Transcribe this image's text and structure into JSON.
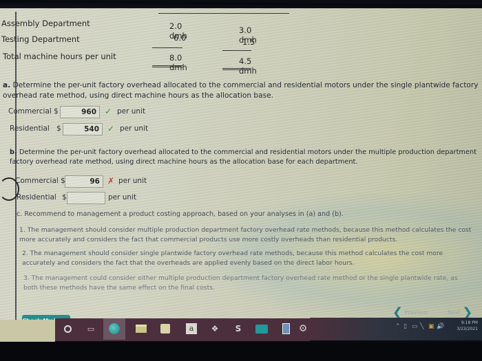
{
  "hours_table": {
    "rows": [
      {
        "label": "Assembly Department",
        "commercial": "2.0 dmh",
        "residential": "3.0 dmh"
      },
      {
        "label": "Testing Department",
        "commercial": "6.0",
        "residential": "1.5"
      },
      {
        "label": "Total machine hours per unit",
        "commercial": "8.0 dmh",
        "residential": "4.5 dmh"
      }
    ]
  },
  "part_a": {
    "letter": "a.",
    "question": "Determine the per-unit factory overhead allocated to the commercial and residential motors under the single plantwide factory overhead rate method, using direct machine hours as the allocation base.",
    "answers": [
      {
        "label": "Commercial",
        "currency": "$",
        "value": "960",
        "status": "correct",
        "mark": "✓",
        "unit": "per unit"
      },
      {
        "label": "Residential",
        "currency": "$",
        "value": "540",
        "status": "correct",
        "mark": "✓",
        "unit": "per unit"
      }
    ]
  },
  "part_b": {
    "letter": "b.",
    "question": "Determine the per-unit factory overhead allocated to the commercial and residential motors under the multiple production department factory overhead rate method, using direct machine hours as the allocation base for each department.",
    "answers": [
      {
        "label": "Commercial",
        "currency": "$",
        "value": "96",
        "status": "incorrect",
        "mark": "✗",
        "unit": "per unit"
      },
      {
        "label": "Residential",
        "currency": "$",
        "value": "",
        "status": "empty",
        "mark": "",
        "unit": "per unit"
      }
    ]
  },
  "part_c": {
    "letter": "c.",
    "question": "Recommend to management a product costing approach, based on your analyses in (a) and (b).",
    "options": [
      "1. The management should consider multiple production department factory overhead rate methods, because this method calculates the cost more accurately and considers the fact that commercial products use more costly overheads than residential products.",
      "2. The management should consider single plantwide factory overhead rate methods, because this method calculates the cost more accurately and considers the fact that the overheads are applied evenly based on the direct labor hours.",
      "3. The management could consider either multiple production department factory overhead rate method or the single plantwide rate, as both these methods have the same effect on the final costs."
    ]
  },
  "footer": {
    "check_my_work": "Check My Work",
    "previous": "Previous",
    "next": "Next"
  },
  "taskbar": {
    "icons": [
      "cortana-icon",
      "task-view-icon",
      "edge-browser-icon",
      "file-explorer-icon",
      "store-icon",
      "amazon-icon",
      "dropbox-icon",
      "app-icon",
      "mail-icon",
      "phone-app-icon",
      "settings-icon"
    ],
    "clock_time": "9:18 PM",
    "clock_date": "3/23/2021"
  },
  "colors": {
    "accent_teal": "#1f8d8d",
    "correct_green": "#3a8a3a",
    "incorrect_red": "#c0392b",
    "taskbar": "#4c2f3c"
  }
}
